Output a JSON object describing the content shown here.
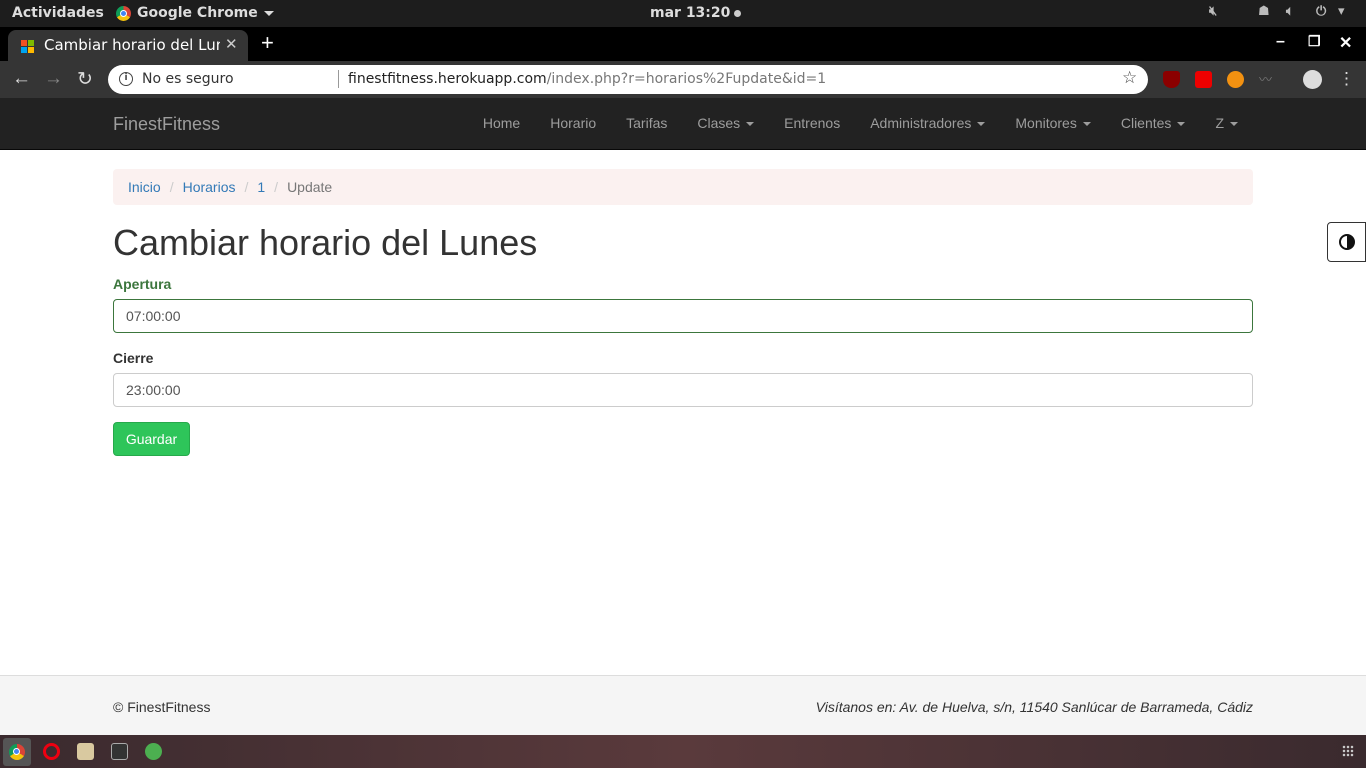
{
  "system_bar": {
    "activities": "Actividades",
    "app_name": "Google Chrome",
    "clock": "mar 13:20"
  },
  "browser": {
    "tab_title": "Cambiar horario del Lunes",
    "url_security": "No es seguro",
    "url_host": "finestfitness.herokuapp.com",
    "url_path": "/index.php?r=horarios%2Fupdate&id=1"
  },
  "navbar": {
    "brand": "FinestFitness",
    "items": [
      {
        "label": "Home",
        "dropdown": false
      },
      {
        "label": "Horario",
        "dropdown": false
      },
      {
        "label": "Tarifas",
        "dropdown": false
      },
      {
        "label": "Clases",
        "dropdown": true
      },
      {
        "label": "Entrenos",
        "dropdown": false
      },
      {
        "label": "Administradores",
        "dropdown": true
      },
      {
        "label": "Monitores",
        "dropdown": true
      },
      {
        "label": "Clientes",
        "dropdown": true
      },
      {
        "label": "Z",
        "dropdown": true
      }
    ]
  },
  "breadcrumb": {
    "items": [
      "Inicio",
      "Horarios",
      "1"
    ],
    "current": "Update"
  },
  "page": {
    "title": "Cambiar horario del Lunes",
    "opening_label": "Apertura",
    "opening_value": "07:00:00",
    "closing_label": "Cierre",
    "closing_value": "23:00:00",
    "save_label": "Guardar"
  },
  "footer": {
    "copyright": "© FinestFitness",
    "address": "Visítanos en: Av. de Huelva, s/n, 11540 Sanlúcar de Barrameda, Cádiz"
  },
  "colors": {
    "navbar_bg": "#222222",
    "link": "#337ab7",
    "success": "#3c763d",
    "save_button": "#2ec55a"
  }
}
